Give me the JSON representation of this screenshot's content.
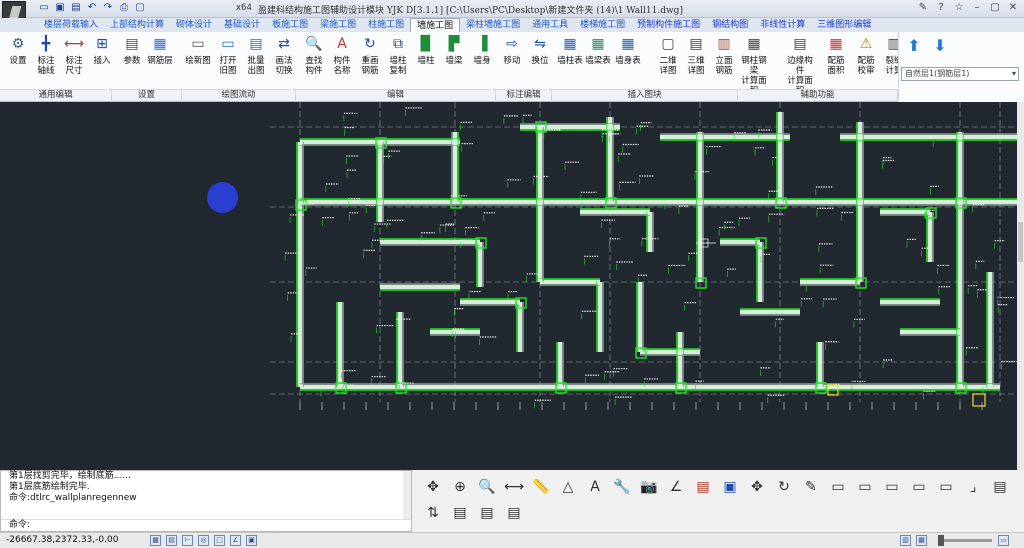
{
  "titlebar": {
    "app": "x64",
    "title": "盈建科结构施工图辅助设计模块   YJK D[3.1.1]   [C:\\Users\\PC\\Desktop\\新建文件夹 (14)\\1   Wall11.dwg]",
    "qat_icons": [
      "new-icon",
      "save-icon",
      "open-icon",
      "undo-icon",
      "redo-icon",
      "print-icon",
      "preview-icon"
    ]
  },
  "ribbon_tabs": [
    "楼层荷载输入",
    "上部结构计算",
    "砌体设计",
    "基础设计",
    "板施工图",
    "梁施工图",
    "柱施工图",
    "墙施工图",
    "梁柱墙施工图",
    "通用工具",
    "楼梯施工图",
    "预制构件施工图",
    "钢结构图",
    "非线性计算",
    "三维图形编辑"
  ],
  "active_tab": "墙施工图",
  "tools": [
    {
      "label": "设置",
      "icon": "gear-icon"
    },
    {
      "label": "标注\n轴线",
      "icon": "axis-icon"
    },
    {
      "label": "标注\n尺寸",
      "icon": "dimension-icon"
    },
    {
      "label": "插入",
      "icon": "insert-icon"
    },
    {
      "label": "参数",
      "icon": "params-icon"
    },
    {
      "label": "钢筋层",
      "icon": "rebar-layer-icon"
    },
    {
      "label": "绘新图",
      "icon": "new-drawing-icon"
    },
    {
      "label": "打开\n旧图",
      "icon": "open-drawing-icon"
    },
    {
      "label": "批量\n出图",
      "icon": "batch-icon"
    },
    {
      "label": "画法\n切换",
      "icon": "switch-icon"
    },
    {
      "label": "查找\n构件",
      "icon": "find-icon"
    },
    {
      "label": "构件\n名称",
      "icon": "name-icon"
    },
    {
      "label": "重画\n钢筋",
      "icon": "redraw-icon"
    },
    {
      "label": "墙柱\n复制",
      "icon": "copy-icon"
    },
    {
      "label": "墙柱",
      "icon": "wall-column-icon"
    },
    {
      "label": "墙梁",
      "icon": "wall-beam-icon"
    },
    {
      "label": "墙身",
      "icon": "wall-body-icon"
    },
    {
      "label": "移动",
      "icon": "move-icon"
    },
    {
      "label": "换位",
      "icon": "swap-icon"
    },
    {
      "label": "墙柱表",
      "icon": "column-table-icon"
    },
    {
      "label": "墙梁表",
      "icon": "beam-table-icon"
    },
    {
      "label": "墙身表",
      "icon": "body-table-icon"
    },
    {
      "label": "二维\n详图",
      "icon": "2d-detail-icon"
    },
    {
      "label": "三维\n详图",
      "icon": "3d-detail-icon"
    },
    {
      "label": "立面\n钢筋",
      "icon": "elevation-icon"
    },
    {
      "label": "钢柱钢梁\n计算面积",
      "icon": "area-icon"
    },
    {
      "label": "边缘构件\n计算面积",
      "icon": "edge-area-icon"
    },
    {
      "label": "配筋\n面积",
      "icon": "rebar-area-icon"
    },
    {
      "label": "配筋\n校审",
      "icon": "check-icon"
    },
    {
      "label": "裂缝\n计算",
      "icon": "crack-icon"
    }
  ],
  "groups": [
    "通用编辑",
    "设置",
    "绘图流动",
    "编辑",
    "标注编辑",
    "插入图块",
    "辅助功能"
  ],
  "floor_select": "自然层1(钢筋层1)",
  "command": {
    "lines": [
      "第1层找剪完毕，绘制底筋......",
      "第1层底筋绘制完毕.",
      "命令:dtlrc_wallplanregennew"
    ],
    "prompt": "命令:"
  },
  "status": {
    "coords": "-26667.38,2372.33,-0.00"
  },
  "bottom_tools": [
    "pan-icon",
    "zoom-window-icon",
    "zoom-icon",
    "measure-icon",
    "ruler-icon",
    "angle-icon",
    "text-icon",
    "wrench-icon",
    "camera-icon",
    "angle-50-icon",
    "pdf-icon",
    "dwg-icon",
    "move-icon",
    "rotate-icon",
    "brush-icon",
    "block-1-icon",
    "block-2-icon",
    "block-3-icon",
    "block-4-icon",
    "block-5-icon",
    "corner-icon",
    "export-icon",
    "flip-icon",
    "layers-icon",
    "list-icon",
    "doc-icon"
  ],
  "colors": {
    "canvas": "#212830",
    "wall": "#d6efd9",
    "rebar": "#26e32a",
    "axis": "#9aa3a8"
  }
}
